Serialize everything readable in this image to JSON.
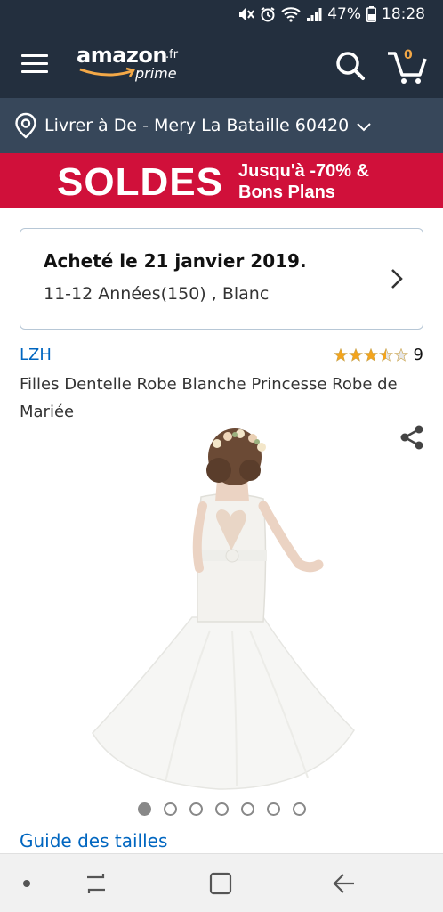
{
  "status_bar": {
    "battery": "47%",
    "time": "18:28"
  },
  "header": {
    "logo_text": "amazon",
    "logo_tld": ".fr",
    "logo_prime": "prime",
    "cart_count": "0",
    "icons": [
      "menu-icon",
      "search-icon",
      "cart-icon"
    ]
  },
  "delivery": {
    "text": "Livrer à De - Mery La Bataille 60420"
  },
  "banner": {
    "title": "SOLDES",
    "subtitle_line1": "Jusqu'à -70% &",
    "subtitle_line2": "Bons Plans",
    "color": "#d0103a"
  },
  "order": {
    "title": "Acheté le 21 janvier 2019.",
    "details": "11-12 Années(150) , Blanc"
  },
  "product": {
    "brand": "LZH",
    "rating": 3.5,
    "rating_max": 5,
    "review_count": "9",
    "title": "Filles Dentelle Robe Blanche Princesse Robe de Mariée",
    "image_count": 7,
    "active_image": 1
  },
  "links": {
    "size_guide": "Guide des tailles"
  },
  "colors": {
    "header_bg": "#232f3e",
    "delivery_bg": "#37475a",
    "link": "#0066c0",
    "star": "#f4a41c"
  }
}
